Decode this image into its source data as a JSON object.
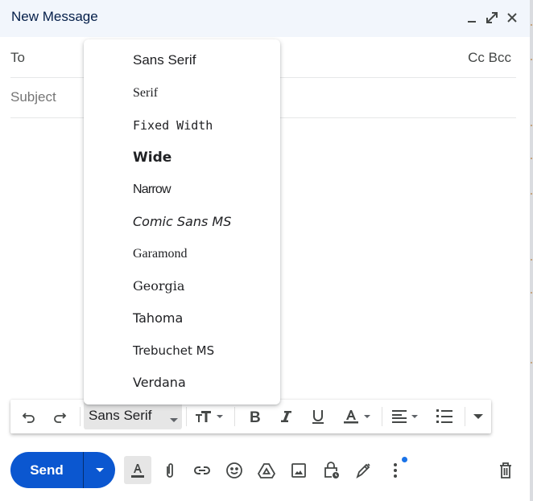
{
  "window": {
    "title": "New Message",
    "controls": [
      "minimize",
      "full-screen",
      "close"
    ]
  },
  "fields": {
    "to_label": "To",
    "cc_label": "Cc",
    "bcc_label": "Bcc",
    "subject_placeholder": "Subject"
  },
  "font_menu": {
    "items": [
      {
        "label": "Sans Serif"
      },
      {
        "label": "Serif"
      },
      {
        "label": "Fixed Width"
      },
      {
        "label": "Wide"
      },
      {
        "label": "Narrow"
      },
      {
        "label": "Comic Sans MS"
      },
      {
        "label": "Garamond"
      },
      {
        "label": "Georgia"
      },
      {
        "label": "Tahoma"
      },
      {
        "label": "Trebuchet MS"
      },
      {
        "label": "Verdana"
      }
    ]
  },
  "toolbar": {
    "font_value": "Sans Serif",
    "buttons": [
      "undo",
      "redo",
      "font",
      "size",
      "bold",
      "italic",
      "underline",
      "text-color",
      "align",
      "numbered-list",
      "more-formatting"
    ]
  },
  "bottom": {
    "send_label": "Send",
    "icons": [
      "formatting-options",
      "attach-files",
      "insert-link",
      "insert-emoji",
      "insert-drive-files",
      "insert-photo",
      "confidential-mode",
      "insert-signature",
      "more-options",
      "discard-draft"
    ]
  },
  "colors": {
    "send_blue": "#0b57d0",
    "header_bg": "#f2f6fc",
    "notification_dot": "#1a73e8"
  }
}
